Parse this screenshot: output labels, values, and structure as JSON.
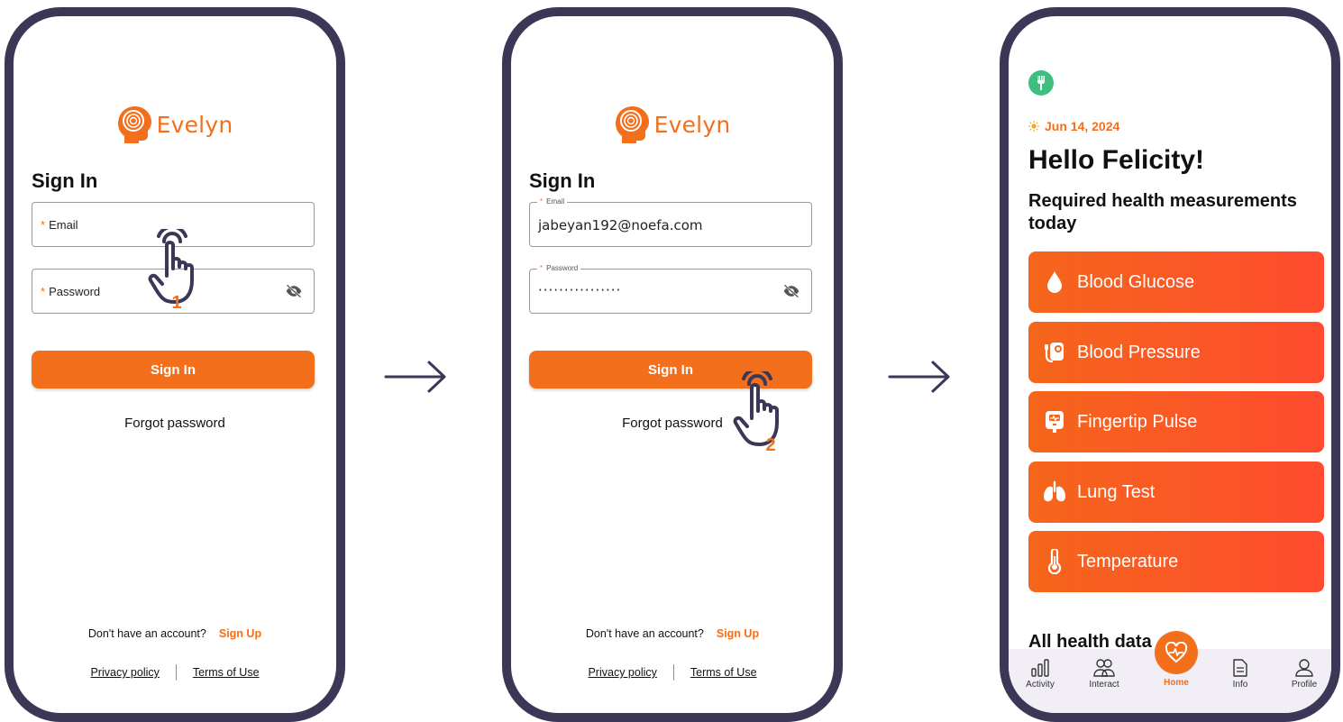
{
  "colors": {
    "brand": "#f36f1c",
    "frame": "#3a3856",
    "green": "#3fbf7f",
    "nav_bg": "#f1eef6"
  },
  "brand": {
    "name": "Evelyn"
  },
  "screen1": {
    "title": "Sign In",
    "email_placeholder": "Email",
    "password_placeholder": "Password",
    "required_mark": "*",
    "signin_label": "Sign In",
    "forgot_label": "Forgot password",
    "no_account_text": "Don't have an account?",
    "signup_label": "Sign Up",
    "privacy_label": "Privacy policy",
    "terms_label": "Terms of Use",
    "step": "1"
  },
  "screen2": {
    "title": "Sign In",
    "email_label": "Email",
    "email_value": "jabeyan192@noefa.com",
    "password_label": "Password",
    "password_value": "················",
    "required_mark": "*",
    "signin_label": "Sign In",
    "forgot_label": "Forgot password",
    "no_account_text": "Don't have an account?",
    "signup_label": "Sign Up",
    "privacy_label": "Privacy policy",
    "terms_label": "Terms of Use",
    "step": "2"
  },
  "home": {
    "date": "Jun 14, 2024",
    "greeting": "Hello Felicity!",
    "required_title": "Required health measurements today",
    "measurements": [
      {
        "label": "Blood Glucose",
        "icon": "drop-icon"
      },
      {
        "label": "Blood Pressure",
        "icon": "blood-pressure-icon"
      },
      {
        "label": "Fingertip Pulse",
        "icon": "pulse-oximeter-icon"
      },
      {
        "label": "Lung Test",
        "icon": "lungs-icon"
      },
      {
        "label": "Temperature",
        "icon": "thermometer-icon"
      }
    ],
    "all_health": "All health data",
    "nav": {
      "activity": "Activity",
      "interact": "Interact",
      "home": "Home",
      "info": "Info",
      "profile": "Profile"
    }
  }
}
